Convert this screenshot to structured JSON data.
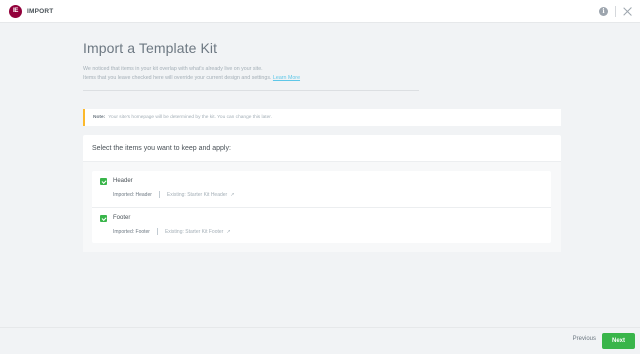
{
  "header": {
    "logo_text": "IE",
    "title": "IMPORT",
    "info_icon_glyph": "i"
  },
  "main": {
    "title": "Import a Template Kit",
    "description_line1": "We noticed that items in your kit overlap with what's already live on your site.",
    "description_line2": "Items that you leave checked here will override your current design and settings.",
    "learn_more": "Learn More"
  },
  "notice": {
    "label": "Note:",
    "text": "Your site's homepage will be determined by the kit. You can change this later."
  },
  "card": {
    "heading": "Select the items you want to keep and apply:",
    "items": [
      {
        "name": "Header",
        "imported": "Imported: Header",
        "existing": "Existing: Starter Kit Header",
        "ext_icon": "↗",
        "checked": true
      },
      {
        "name": "Footer",
        "imported": "Imported: Footer",
        "existing": "Existing: Starter Kit Footer",
        "ext_icon": "↗",
        "checked": true
      }
    ]
  },
  "footer": {
    "previous_label": "Previous",
    "next_label": "Next"
  },
  "colors": {
    "brand": "#92003b",
    "accent_green": "#39b54a",
    "link": "#5fc7e8",
    "notice_border": "#fcb92c"
  },
  "icons": [
    "elementor-logo-icon",
    "info-icon",
    "close-icon",
    "checkbox-checked-icon",
    "external-link-icon"
  ]
}
